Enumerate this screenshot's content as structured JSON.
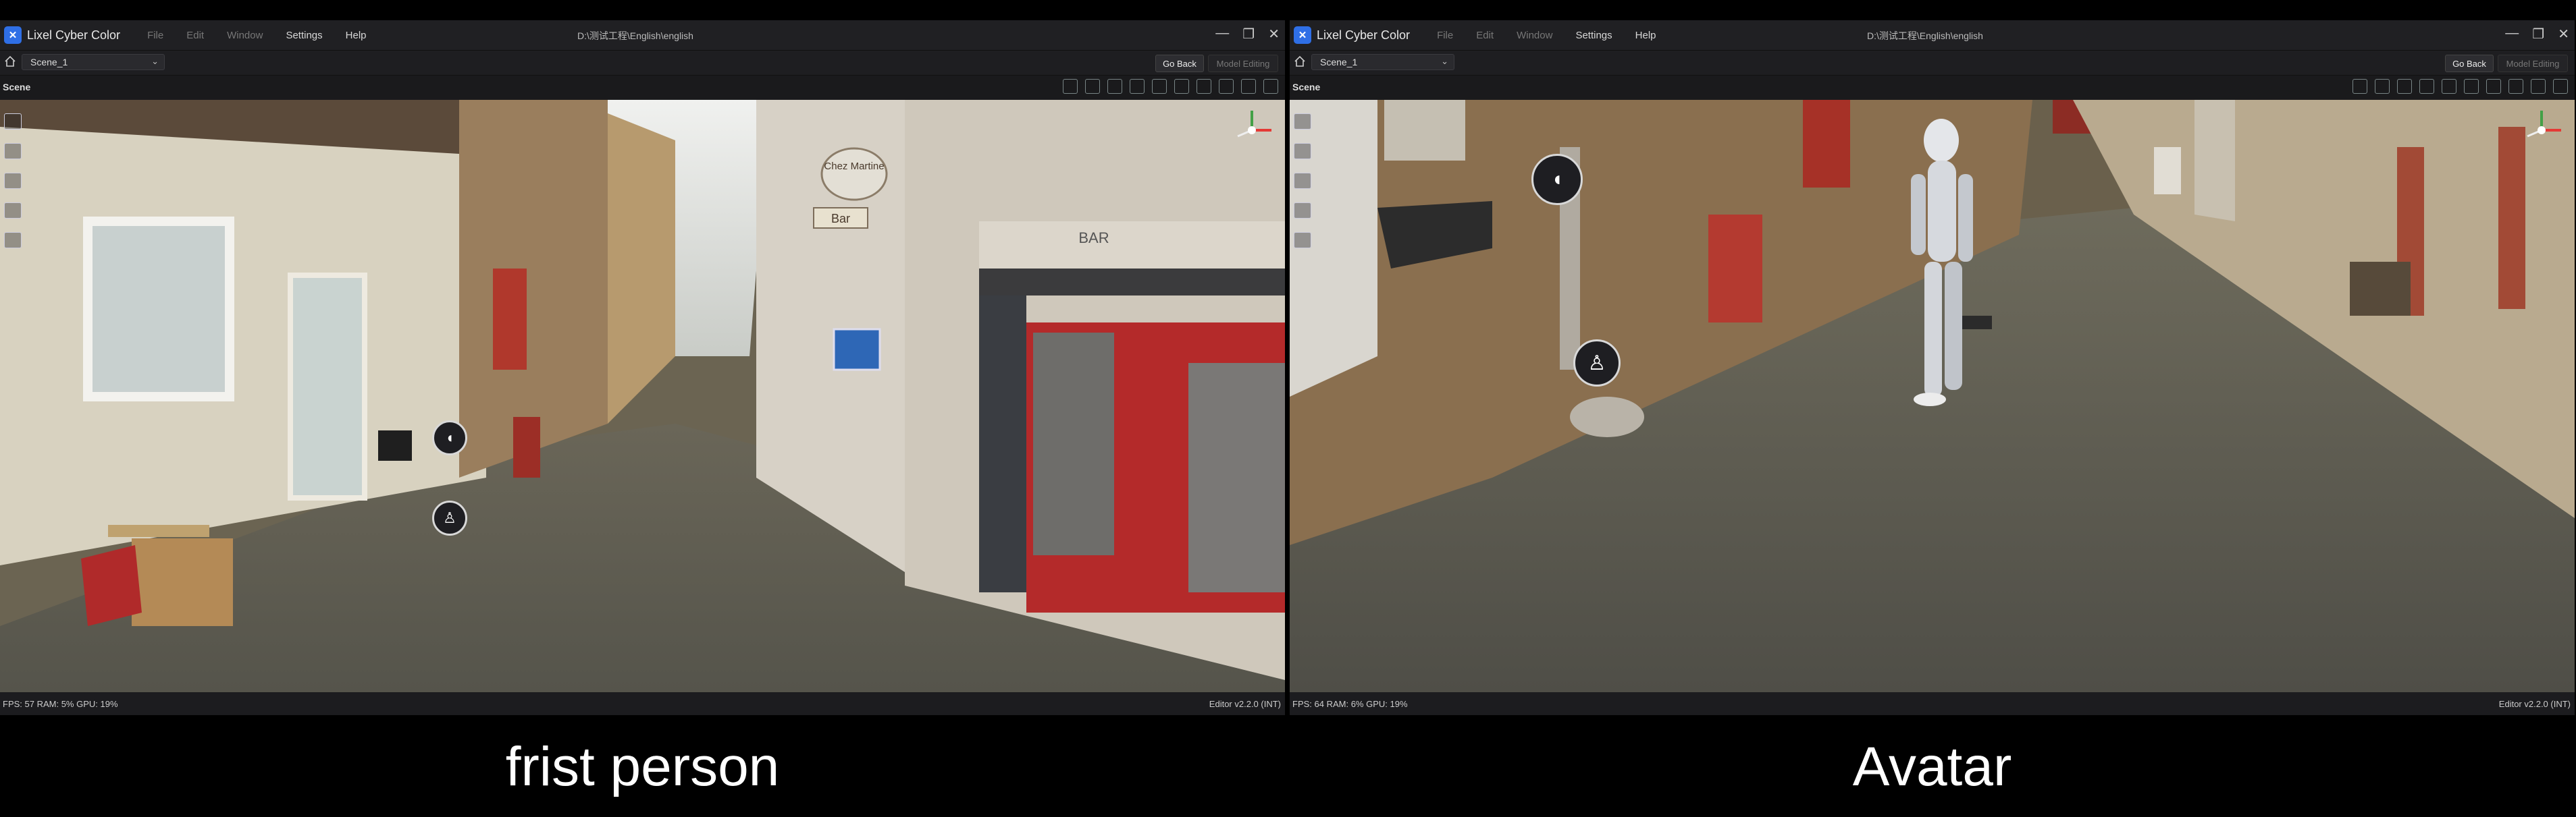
{
  "panels": [
    {
      "app_title": "Lixel Cyber Color",
      "menu": [
        "File",
        "Edit",
        "Window",
        "Settings",
        "Help"
      ],
      "path": "D:\\测试工程\\English\\english",
      "scene_select": "Scene_1",
      "go_back": "Go Back",
      "model_editing": "Model Editing",
      "scene_label": "Scene",
      "status_left": "FPS: 57  RAM: 5%  GPU: 19%",
      "status_right": "Editor v2.2.0 (INT)",
      "caption": "frist person"
    },
    {
      "app_title": "Lixel Cyber Color",
      "menu": [
        "File",
        "Edit",
        "Window",
        "Settings",
        "Help"
      ],
      "path": "D:\\测试工程\\English\\english",
      "scene_select": "Scene_1",
      "go_back": "Go Back",
      "model_editing": "Model Editing",
      "scene_label": "Scene",
      "status_left": "FPS: 64  RAM: 6%  GPU: 19%",
      "status_right": "Editor v2.2.0 (INT)",
      "caption": "Avatar"
    }
  ],
  "scene_signs": {
    "shop_sign": "Chez Martine",
    "bar_sign": "Bar",
    "awning": "BAR"
  },
  "icons": {
    "logo": "lixel-logo-icon",
    "home": "home-icon",
    "left_tools": [
      "list-icon",
      "focus-icon",
      "ruler-icon",
      "comment-icon",
      "document-icon"
    ],
    "view_tools": [
      "measure-icon",
      "layers-icon",
      "shapes-icon",
      "terrain-icon",
      "pin-icon",
      "3d-view-icon",
      "grid-icon",
      "crop-icon",
      "annotate-icon",
      "cone-icon"
    ]
  },
  "colors": {
    "accent": "#2f6fe6",
    "gizmo_x": "#e53935",
    "gizmo_y": "#43a047"
  }
}
